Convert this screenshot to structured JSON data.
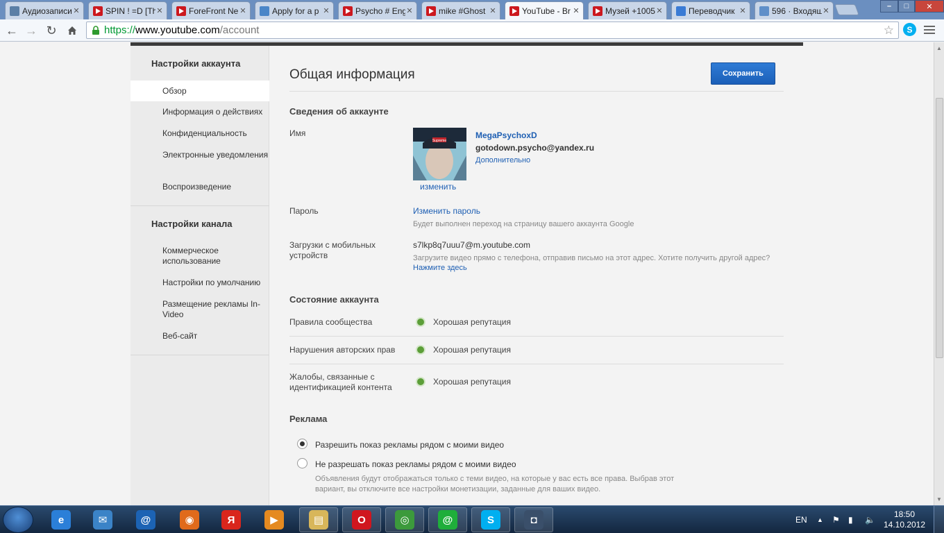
{
  "browser": {
    "tabs": [
      {
        "title": "Аудиозаписи",
        "icon": "vk-audio-icon",
        "color": "#5b7fa6"
      },
      {
        "title": "SPIN ! =D [Th",
        "icon": "youtube-icon",
        "color": "#cc181e"
      },
      {
        "title": "ForeFront Ne",
        "icon": "youtube-icon",
        "color": "#cc181e"
      },
      {
        "title": "Apply for a p",
        "icon": "forefront-icon",
        "color": "#4a86c8"
      },
      {
        "title": "Psycho # Eng",
        "icon": "youtube-icon",
        "color": "#cc181e"
      },
      {
        "title": "mike #Ghost",
        "icon": "youtube-icon",
        "color": "#cc181e"
      },
      {
        "title": "YouTube - Br",
        "icon": "youtube-icon",
        "color": "#cc181e"
      },
      {
        "title": "Музей +1005",
        "icon": "youtube-icon",
        "color": "#cc181e"
      },
      {
        "title": "Переводчик",
        "icon": "translate-icon",
        "color": "#3a7bd5"
      },
      {
        "title": "596 · Входящ",
        "icon": "mail-icon",
        "color": "#5f8fc9"
      }
    ],
    "close_glyph": "✕",
    "url": {
      "scheme": "https://",
      "host": "www.youtube.com",
      "path": "/account"
    }
  },
  "sidebar": {
    "account_heading": "Настройки аккаунта",
    "account_items": [
      "Обзор",
      "Информация о действиях",
      "Конфиденциальность",
      "Электронные уведомления",
      "Воспроизведение"
    ],
    "channel_heading": "Настройки канала",
    "channel_items": [
      "Коммерческое использование",
      "Настройки по умолчанию",
      "Размещение рекламы In-Video",
      "Веб-сайт"
    ]
  },
  "main": {
    "title": "Общая информация",
    "save_label": "Сохранить",
    "account_info": {
      "heading": "Сведения об аккаунте",
      "name_label": "Имя",
      "username": "MegaPsychoxD",
      "email": "gotodown.psycho@yandex.ru",
      "more_link": "Дополнительно",
      "change_avatar": "изменить",
      "avatar_cap_text": "Supreme",
      "password_label": "Пароль",
      "change_password": "Изменить пароль",
      "password_hint": "Будет выполнен переход на страницу вашего аккаунта Google",
      "mobile_label": "Загрузки с мобильных устройств",
      "mobile_email": "s7lkp8q7uuu7@m.youtube.com",
      "mobile_hint": "Загрузите видео прямо с телефона, отправив письмо на этот адрес. Хотите получить другой адрес?",
      "mobile_link": "Нажмите здесь"
    },
    "account_status": {
      "heading": "Состояние аккаунта",
      "rows": [
        {
          "label": "Правила сообщества",
          "status": "Хорошая репутация"
        },
        {
          "label": "Нарушения авторских прав",
          "status": "Хорошая репутация"
        },
        {
          "label": "Жалобы, связанные с идентификацией контента",
          "status": "Хорошая репутация"
        }
      ],
      "status_color": "#5c9e38"
    },
    "ads": {
      "heading": "Реклама",
      "option_allow": "Разрешить показ рекламы рядом с моими видео",
      "option_deny": "Не разрешать показ рекламы рядом с моими видео",
      "deny_hint": "Объявления будут отображаться только с теми видео, на которые у вас есть все права. Выбрав этот вариант, вы отключите все настройки монетизации, заданные для ваших видео.",
      "selected": "allow"
    }
  },
  "taskbar": {
    "apps": [
      {
        "name": "internet-explorer-icon",
        "glyph": "e",
        "color": "#2b7fd8"
      },
      {
        "name": "mail-client-icon",
        "glyph": "✉",
        "color": "#3b83c7"
      },
      {
        "name": "at-mail-icon",
        "glyph": "@",
        "color": "#1c63b4"
      },
      {
        "name": "firefox-icon",
        "glyph": "◉",
        "color": "#e06a1b"
      },
      {
        "name": "yandex-icon",
        "glyph": "Я",
        "color": "#d9261c"
      },
      {
        "name": "media-player-icon",
        "glyph": "▶",
        "color": "#e58a20"
      },
      {
        "name": "explorer-folder-icon",
        "glyph": "▤",
        "color": "#d8b65a"
      },
      {
        "name": "opera-icon",
        "glyph": "O",
        "color": "#d0161f"
      },
      {
        "name": "chrome-icon",
        "glyph": "◎",
        "color": "#3c9a3c"
      },
      {
        "name": "mail-agent-icon",
        "glyph": "@",
        "color": "#1fae3b"
      },
      {
        "name": "skype-icon",
        "glyph": "S",
        "color": "#00aff0"
      },
      {
        "name": "camera-app-icon",
        "glyph": "◘",
        "color": "#3a4f6a"
      }
    ],
    "language": "EN",
    "time": "18:50",
    "date": "14.10.2012"
  }
}
